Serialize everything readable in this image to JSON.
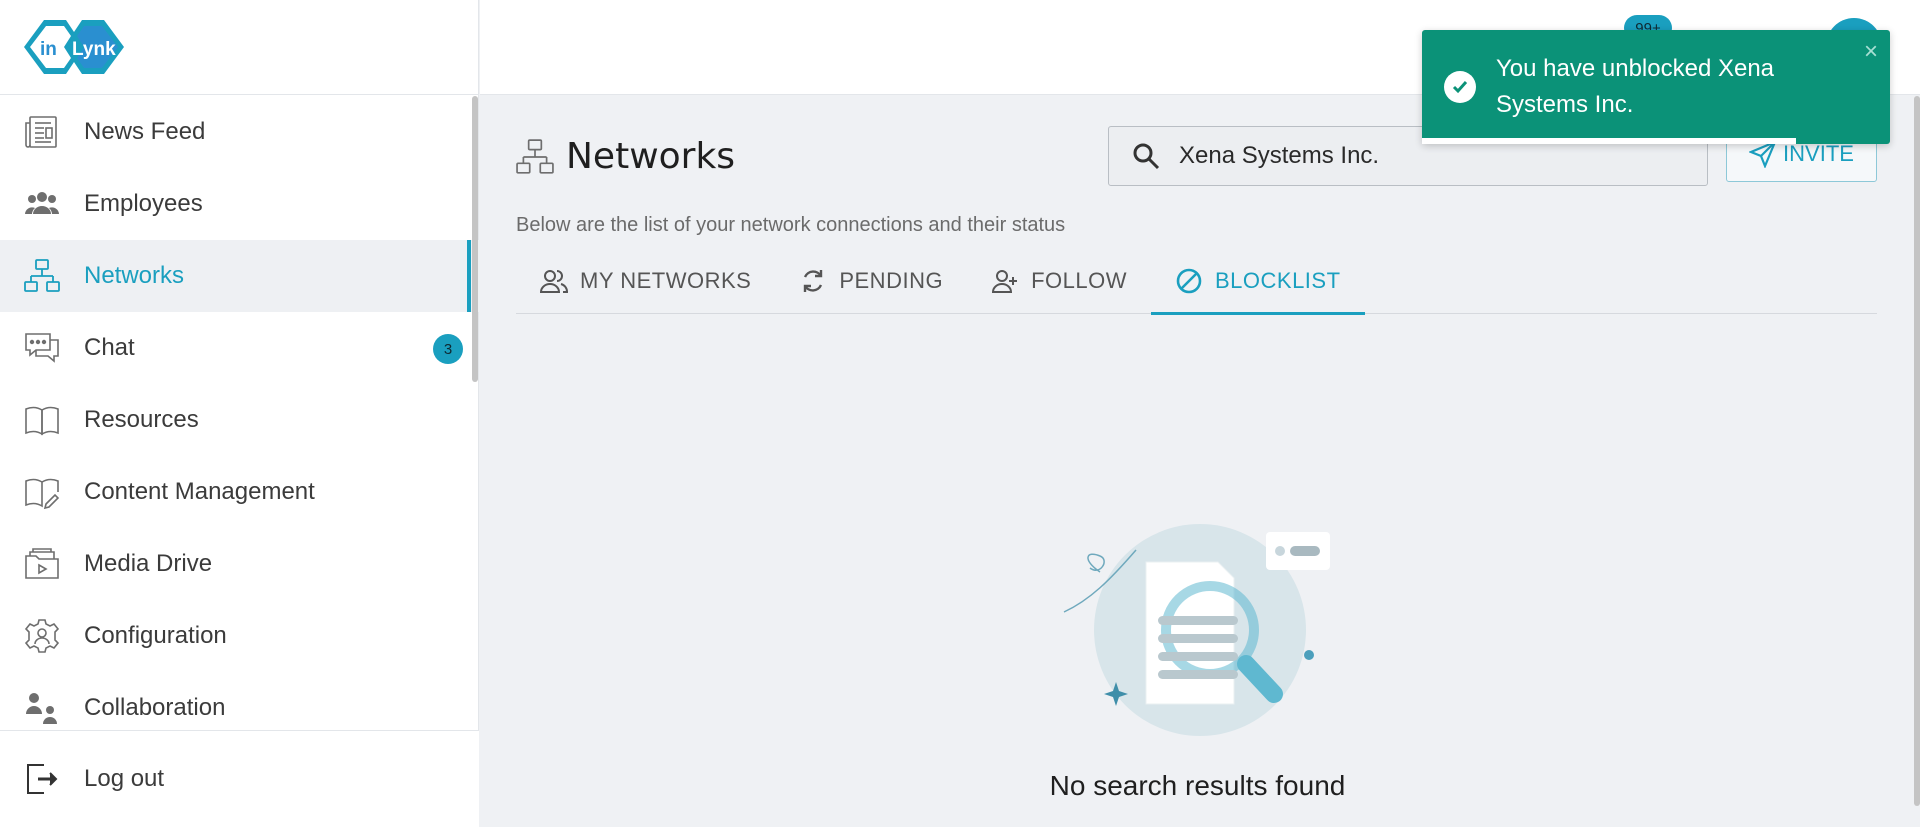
{
  "app": {
    "logo_text": "inLynk"
  },
  "sidebar": {
    "items": [
      {
        "label": "News Feed",
        "icon": "newspaper-icon"
      },
      {
        "label": "Employees",
        "icon": "people-icon"
      },
      {
        "label": "Networks",
        "icon": "network-icon",
        "active": true
      },
      {
        "label": "Chat",
        "icon": "chat-icon",
        "badge": "3"
      },
      {
        "label": "Resources",
        "icon": "book-icon"
      },
      {
        "label": "Content Management",
        "icon": "book-edit-icon"
      },
      {
        "label": "Media Drive",
        "icon": "folder-media-icon"
      },
      {
        "label": "Configuration",
        "icon": "gear-person-icon"
      },
      {
        "label": "Collaboration",
        "icon": "collaboration-icon"
      }
    ],
    "logout_label": "Log out"
  },
  "topbar": {
    "notification_count": "99+"
  },
  "main": {
    "title": "Networks",
    "subtitle": "Below are the list of your network connections and their status",
    "search": {
      "value": "Xena Systems Inc."
    },
    "invite_label": "INVITE",
    "tabs": [
      {
        "label": "MY NETWORKS"
      },
      {
        "label": "PENDING"
      },
      {
        "label": "FOLLOW"
      },
      {
        "label": "BLOCKLIST",
        "active": true
      }
    ],
    "empty_text": "No search results found"
  },
  "toast": {
    "message": "You have unblocked Xena Systems Inc.",
    "close_symbol": "×",
    "progress": 0.8
  },
  "colors": {
    "accent": "#1a9fbf",
    "toast_bg": "#0b9278"
  }
}
